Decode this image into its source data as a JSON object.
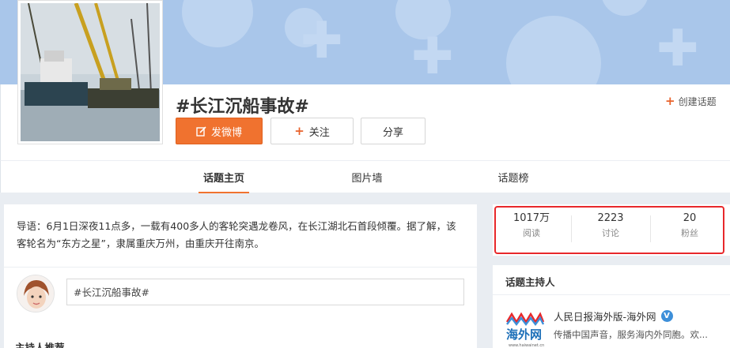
{
  "header": {
    "topic_title": "#长江沉船事故#",
    "create_topic_label": "创建话题",
    "post_button_label": "发微博",
    "follow_button_label": "关注",
    "share_button_label": "分享"
  },
  "tabs": [
    {
      "label": "话题主页",
      "active": true
    },
    {
      "label": "图片墙",
      "active": false
    },
    {
      "label": "话题榜",
      "active": false
    }
  ],
  "intro": {
    "text": "导语：6月1日深夜11点多，一载有400多人的客轮突遇龙卷风，在长江湖北石首段倾覆。据了解，该客轮名为“东方之星”，隶属重庆万州，由重庆开往南京。",
    "post_input_value": "#长江沉船事故#",
    "host_recommend_label": "主持人推荐"
  },
  "stats": [
    {
      "value": "1017万",
      "label": "阅读"
    },
    {
      "value": "2223",
      "label": "讨论"
    },
    {
      "value": "20",
      "label": "粉丝"
    }
  ],
  "host": {
    "title": "话题主持人",
    "name": "人民日报海外版-海外网",
    "logo_text": "海外网",
    "logo_url_text": "www.haiwainet.cn",
    "description": "传播中国声音，服务海内外同胞。欢..."
  },
  "colors": {
    "accent_orange": "#f0722f",
    "highlight_red": "#e8282b",
    "verified_blue": "#3d8fd9",
    "banner_blue": "#a9c6ea"
  }
}
